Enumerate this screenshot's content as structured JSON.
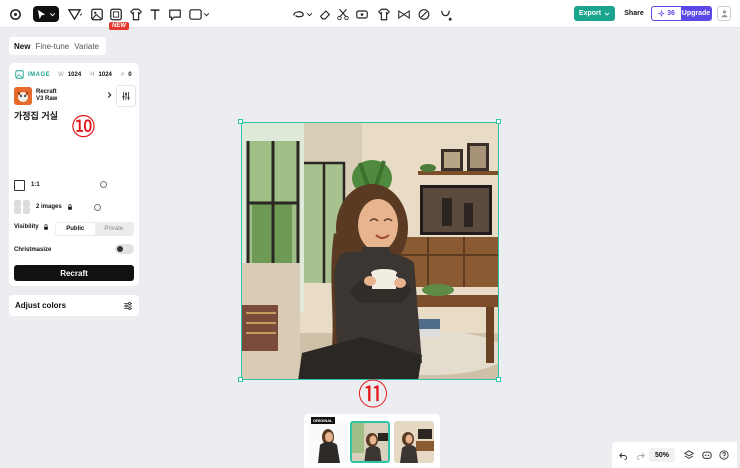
{
  "toolbar": {
    "new_badge": "NEW",
    "export_label": "Export",
    "share_label": "Share",
    "credits": "36",
    "upgrade_label": "Upgrade"
  },
  "tabs": [
    "New",
    "Fine-tune",
    "Variate"
  ],
  "panel": {
    "type_label": "IMAGE",
    "width_key": "W",
    "width_val": "1024",
    "height_key": "H",
    "height_val": "1024",
    "seed_key": "#",
    "seed_val": "0",
    "model_line1": "Recraft",
    "model_line2": "V3 Raw",
    "prompt": "가정집 거실",
    "aspect_ratio": "1:1",
    "image_count": "2 images",
    "visibility_label": "Visibility",
    "visibility_options": [
      "Public",
      "Private"
    ],
    "christmasize_label": "Christmasize",
    "recraft_button": "Recraft",
    "adjust_colors": "Adjust colors"
  },
  "annotations": [
    "⑩",
    "⑪"
  ],
  "thumbnails": {
    "original_tag": "ORIGINAL"
  },
  "zoom": "50%",
  "colors": {
    "accent_green": "#1ca58e",
    "upgrade_purple": "#5a48e8",
    "annotation_red": "#e3181c",
    "new_badge_red": "#e3372f"
  }
}
